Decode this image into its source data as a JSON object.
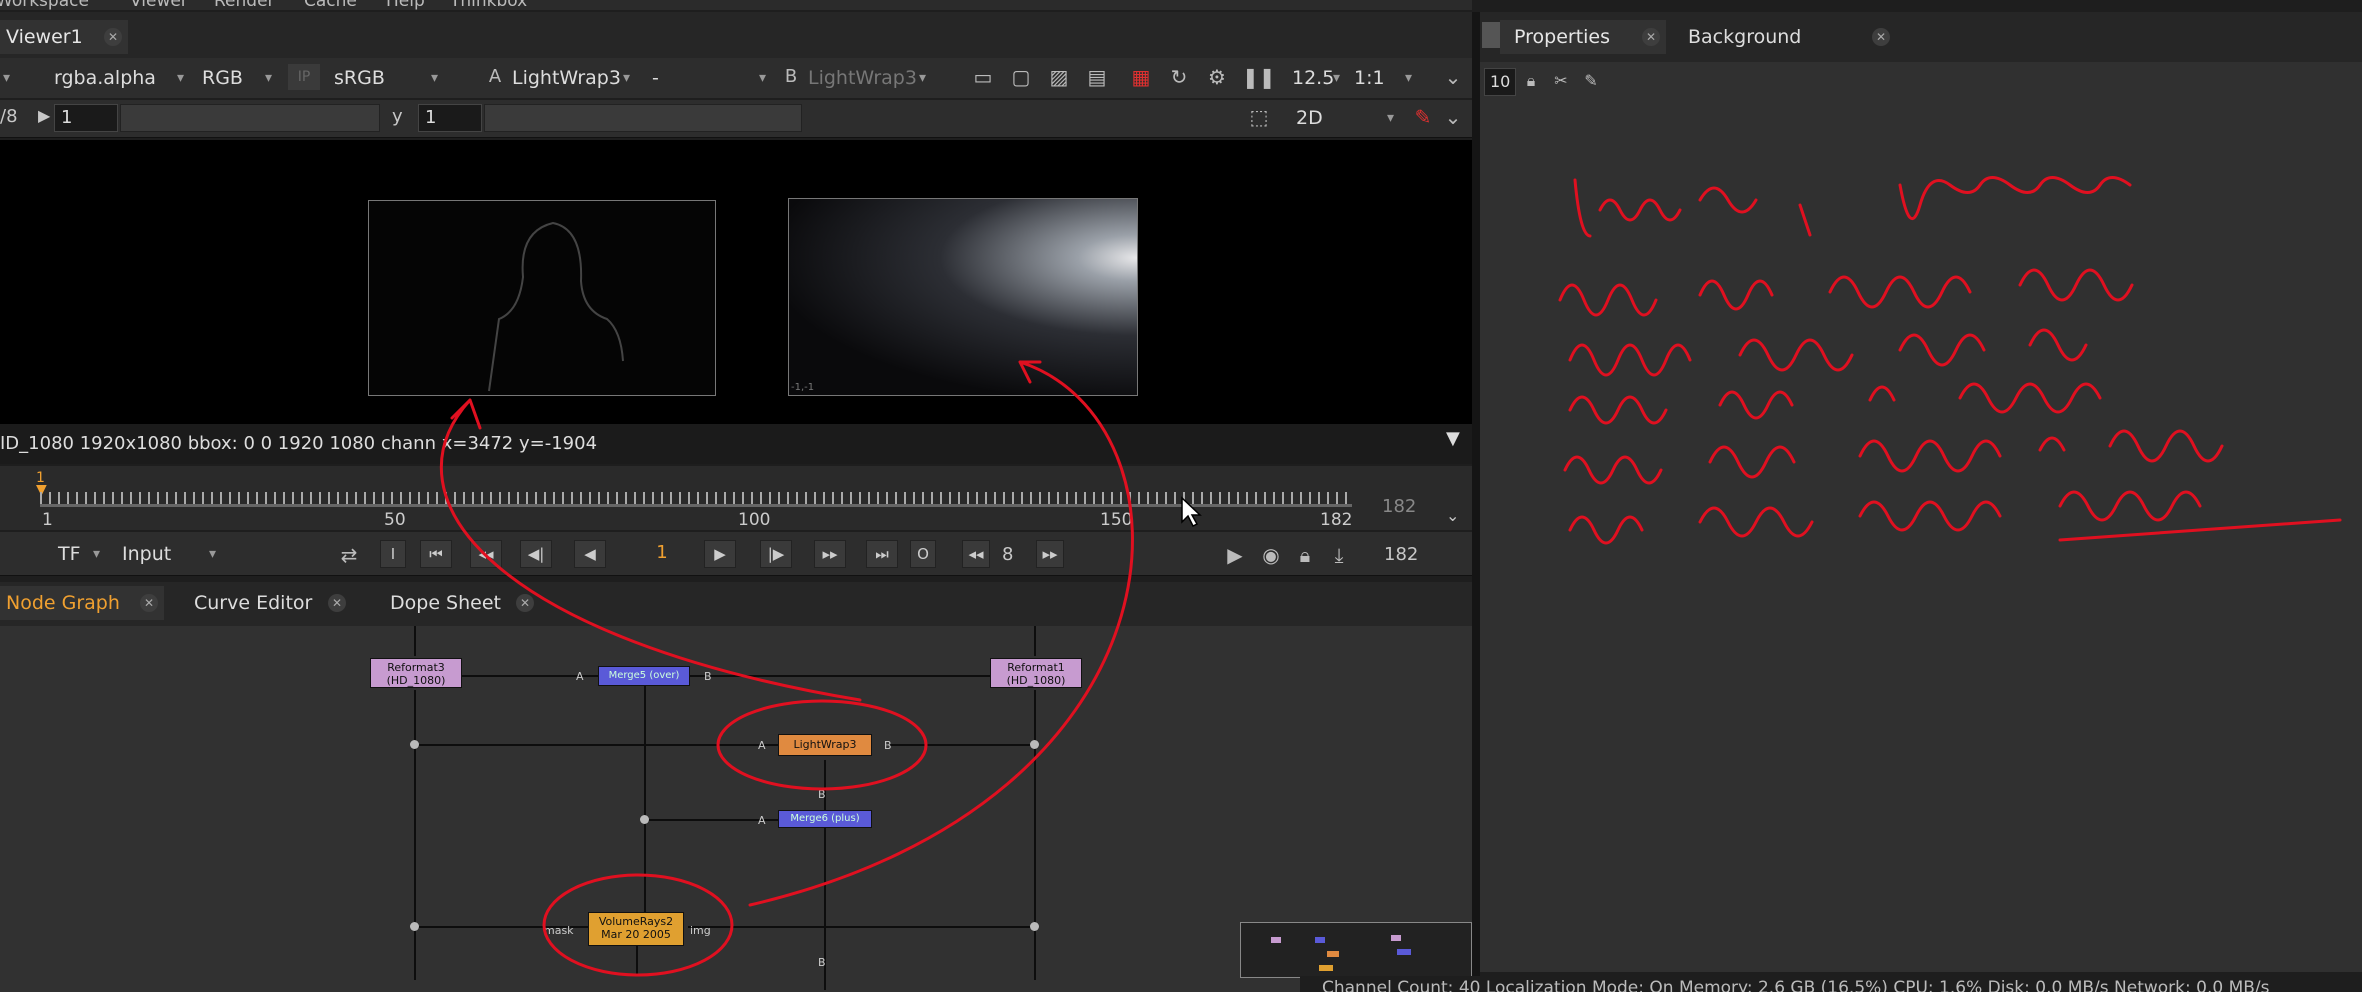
{
  "menubar": {
    "items": [
      "Workspace",
      "Viewer",
      "Render",
      "Cache",
      "Help",
      "Thinkbox"
    ]
  },
  "viewer": {
    "tab_label": "Viewer1",
    "channels": "rgba.alpha",
    "display": "RGB",
    "ip_label": "IP",
    "colorspace": "sRGB",
    "input_a_letter": "A",
    "input_a": "LightWrap3",
    "dash": "-",
    "input_b_letter": "B",
    "input_b": "LightWrap3",
    "zoom": "12.5",
    "ratio": "1:1",
    "frac_label": "/8",
    "gain_value": "1",
    "gamma_label": "y",
    "gamma_value": "1",
    "view_mode": "2D",
    "frame_b_label": "-1,-1",
    "info": "ID_1080 1920x1080  bbox: 0 0 1920 1080 chann  x=3472 y=-1904"
  },
  "timeline": {
    "marks": [
      "1",
      "50",
      "100",
      "150",
      "182"
    ],
    "current_marker": "1",
    "end_frame": "182"
  },
  "playback": {
    "tf": "TF",
    "input_mode": "Input",
    "in_label": "I",
    "out_label": "O",
    "current_frame": "1",
    "skip": "8",
    "end_frame": "182"
  },
  "node_graph": {
    "tabs": [
      "Node Graph",
      "Curve Editor",
      "Dope Sheet"
    ],
    "nodes": {
      "reformat3": {
        "name": "Reformat3",
        "sub": "(HD_1080)"
      },
      "merge5": {
        "name": "Merge5 (over)"
      },
      "reformat1": {
        "name": "Reformat1",
        "sub": "(HD_1080)"
      },
      "lightwrap3": {
        "name": "LightWrap3"
      },
      "merge6": {
        "name": "Merge6 (plus)"
      },
      "volumerays": {
        "name": "VolumeRays2",
        "sub": "Mar 20 2005"
      }
    },
    "port_labels": {
      "a": "A",
      "b": "B",
      "mask": "mask",
      "img": "img"
    }
  },
  "properties": {
    "tabs": [
      "Properties",
      "Background Renders"
    ],
    "max_panels": "10"
  },
  "status_bar": "Channel Count: 40  Localization Mode: On  Memory: 2.6 GB (16.5%)  CPU: 1.6%  Disk: 0.0 MB/s  Network: 0.0 MB/s",
  "colors": {
    "accent": "#f0a030",
    "annotation": "#e01020",
    "viewer_bg": "#000000",
    "panel_bg": "#303030"
  }
}
